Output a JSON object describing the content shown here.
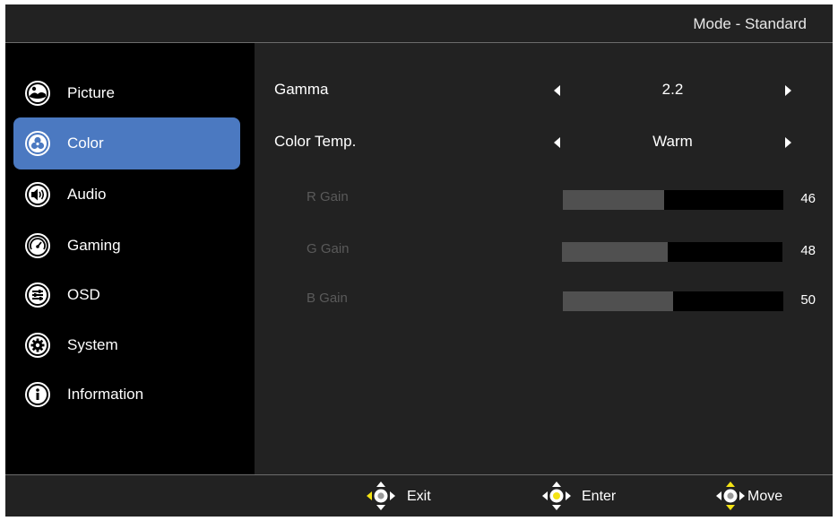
{
  "header": {
    "mode_label": "Mode - Standard"
  },
  "sidebar": {
    "items": [
      {
        "label": "Picture",
        "icon": "picture-icon",
        "active": false
      },
      {
        "label": "Color",
        "icon": "color-icon",
        "active": true
      },
      {
        "label": "Audio",
        "icon": "speaker-icon",
        "active": false
      },
      {
        "label": "Gaming",
        "icon": "gauge-icon",
        "active": false
      },
      {
        "label": "OSD",
        "icon": "sliders-icon",
        "active": false
      },
      {
        "label": "System",
        "icon": "gear-icon",
        "active": false
      },
      {
        "label": "Information",
        "icon": "info-icon",
        "active": false
      }
    ]
  },
  "content": {
    "gamma": {
      "label": "Gamma",
      "value": "2.2"
    },
    "color_temp": {
      "label": "Color Temp.",
      "value": "Warm"
    },
    "gains": [
      {
        "label": "R Gain",
        "value": "46",
        "level": 46
      },
      {
        "label": "G Gain",
        "value": "48",
        "level": 48
      },
      {
        "label": "B Gain",
        "value": "50",
        "level": 50
      }
    ],
    "gain_max": 100
  },
  "footer": {
    "exit_label": "Exit",
    "enter_label": "Enter",
    "move_label": "Move"
  },
  "colors": {
    "active_item": "#4b79c1",
    "highlight": "#f4e313",
    "background": "#222222",
    "sidebar": "#000000"
  }
}
